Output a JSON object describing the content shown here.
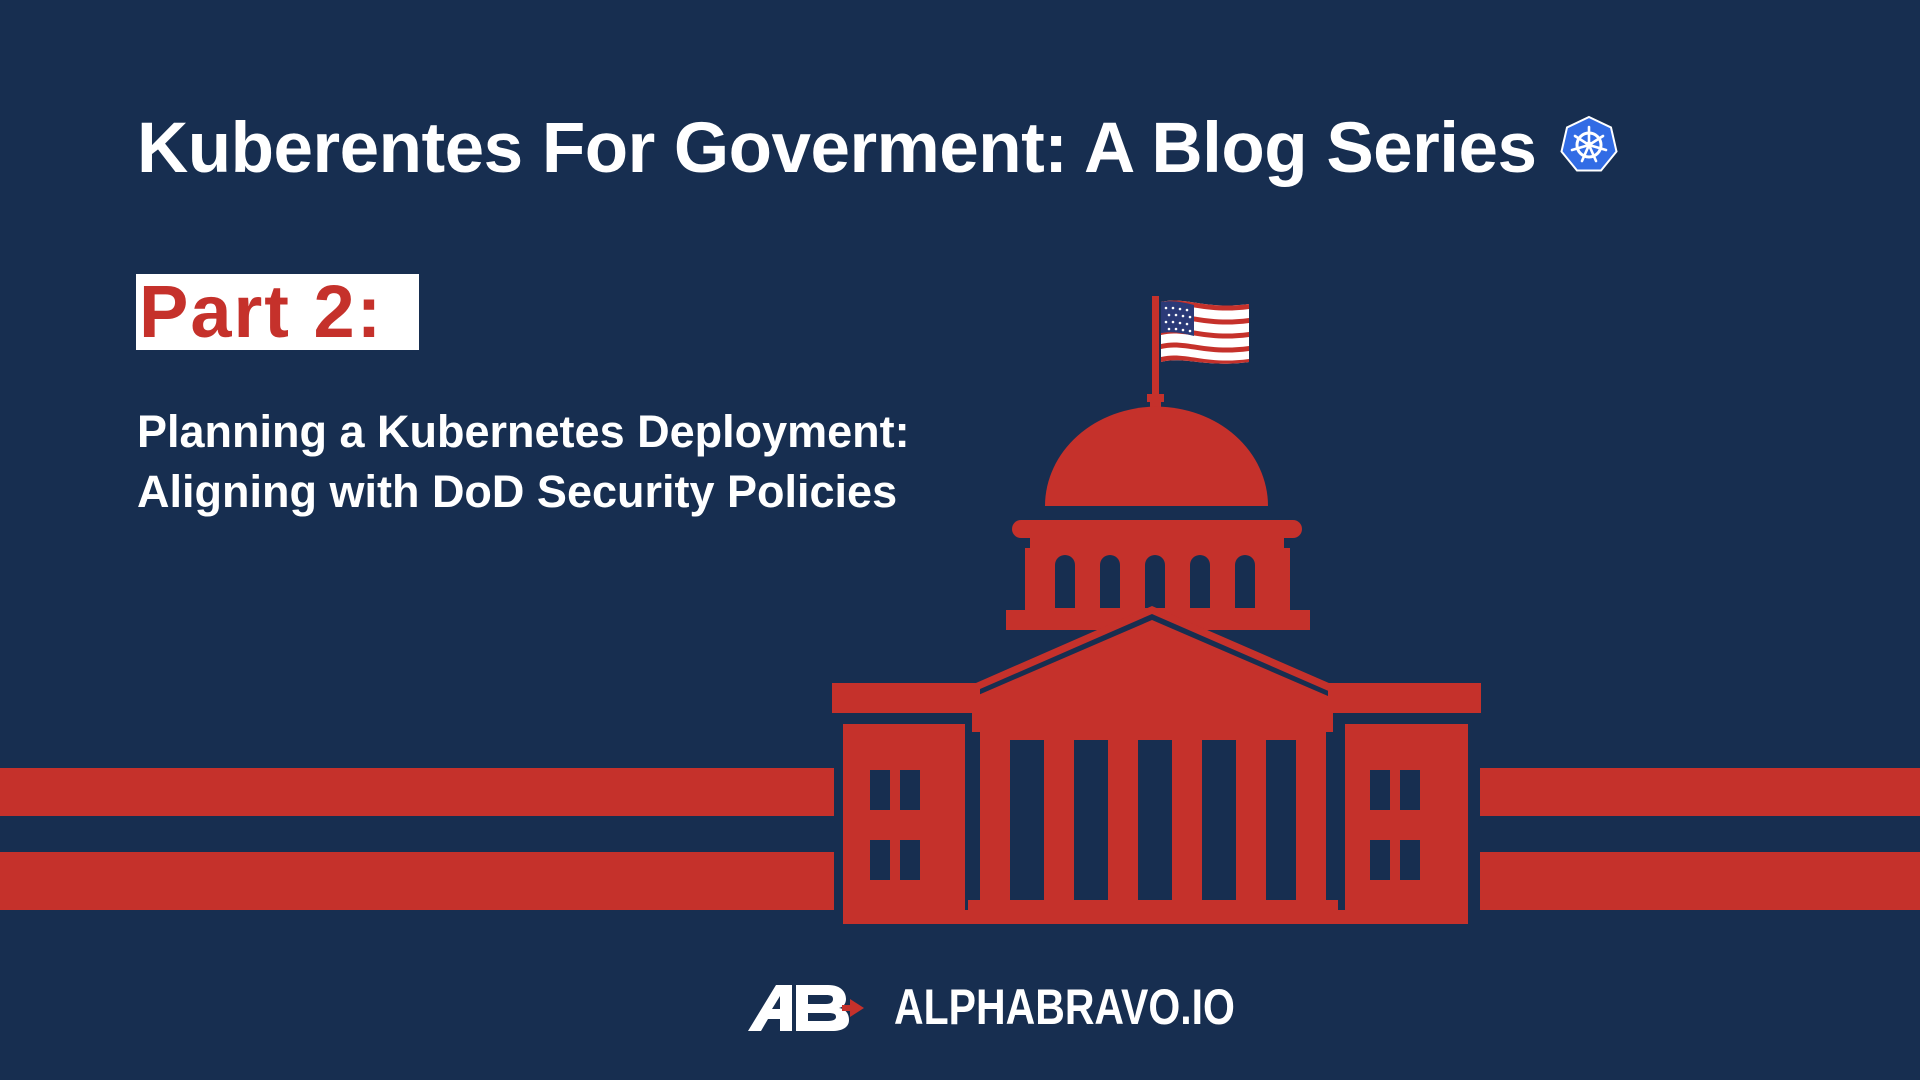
{
  "colors": {
    "background": "#172e50",
    "accent_red": "#c5312b",
    "text_white": "#ffffff",
    "kubernetes_blue": "#326ce5"
  },
  "header": {
    "title": "Kuberentes For Goverment: A Blog Series",
    "title_icon": "kubernetes-helm-icon"
  },
  "part": {
    "label": "Part 2:"
  },
  "subtitle": {
    "line1": "Planning a Kubernetes Deployment:",
    "line2": "Aligning with DoD Security Policies"
  },
  "illustration": {
    "icon": "capitol-building-with-us-flag-icon"
  },
  "footer": {
    "logo_icon": "alphabravo-ab-logo-icon",
    "brand": "ALPHABRAVO.IO"
  }
}
